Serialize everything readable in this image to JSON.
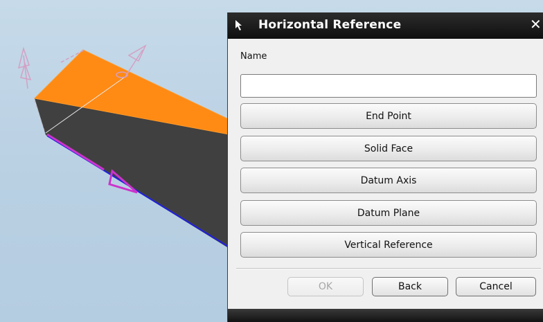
{
  "viewport": {
    "background": "#bcd3e6",
    "body_top_color": "#ff8c14",
    "body_side_color": "#404040",
    "edge_highlight_color": "#cc33cc",
    "edge_blue_color": "#1f1fe0",
    "axis_arrow_color": "#d4a0c4"
  },
  "dialog": {
    "title": "Horizontal Reference",
    "title_icon": "select-arrow-icon",
    "close_icon": "close-icon",
    "close_glyph": "✕",
    "name_label": "Name",
    "name_value": "",
    "options": [
      "End Point",
      "Solid Face",
      "Datum Axis",
      "Datum Plane",
      "Vertical Reference"
    ],
    "ok_label": "OK",
    "back_label": "Back",
    "cancel_label": "Cancel"
  }
}
